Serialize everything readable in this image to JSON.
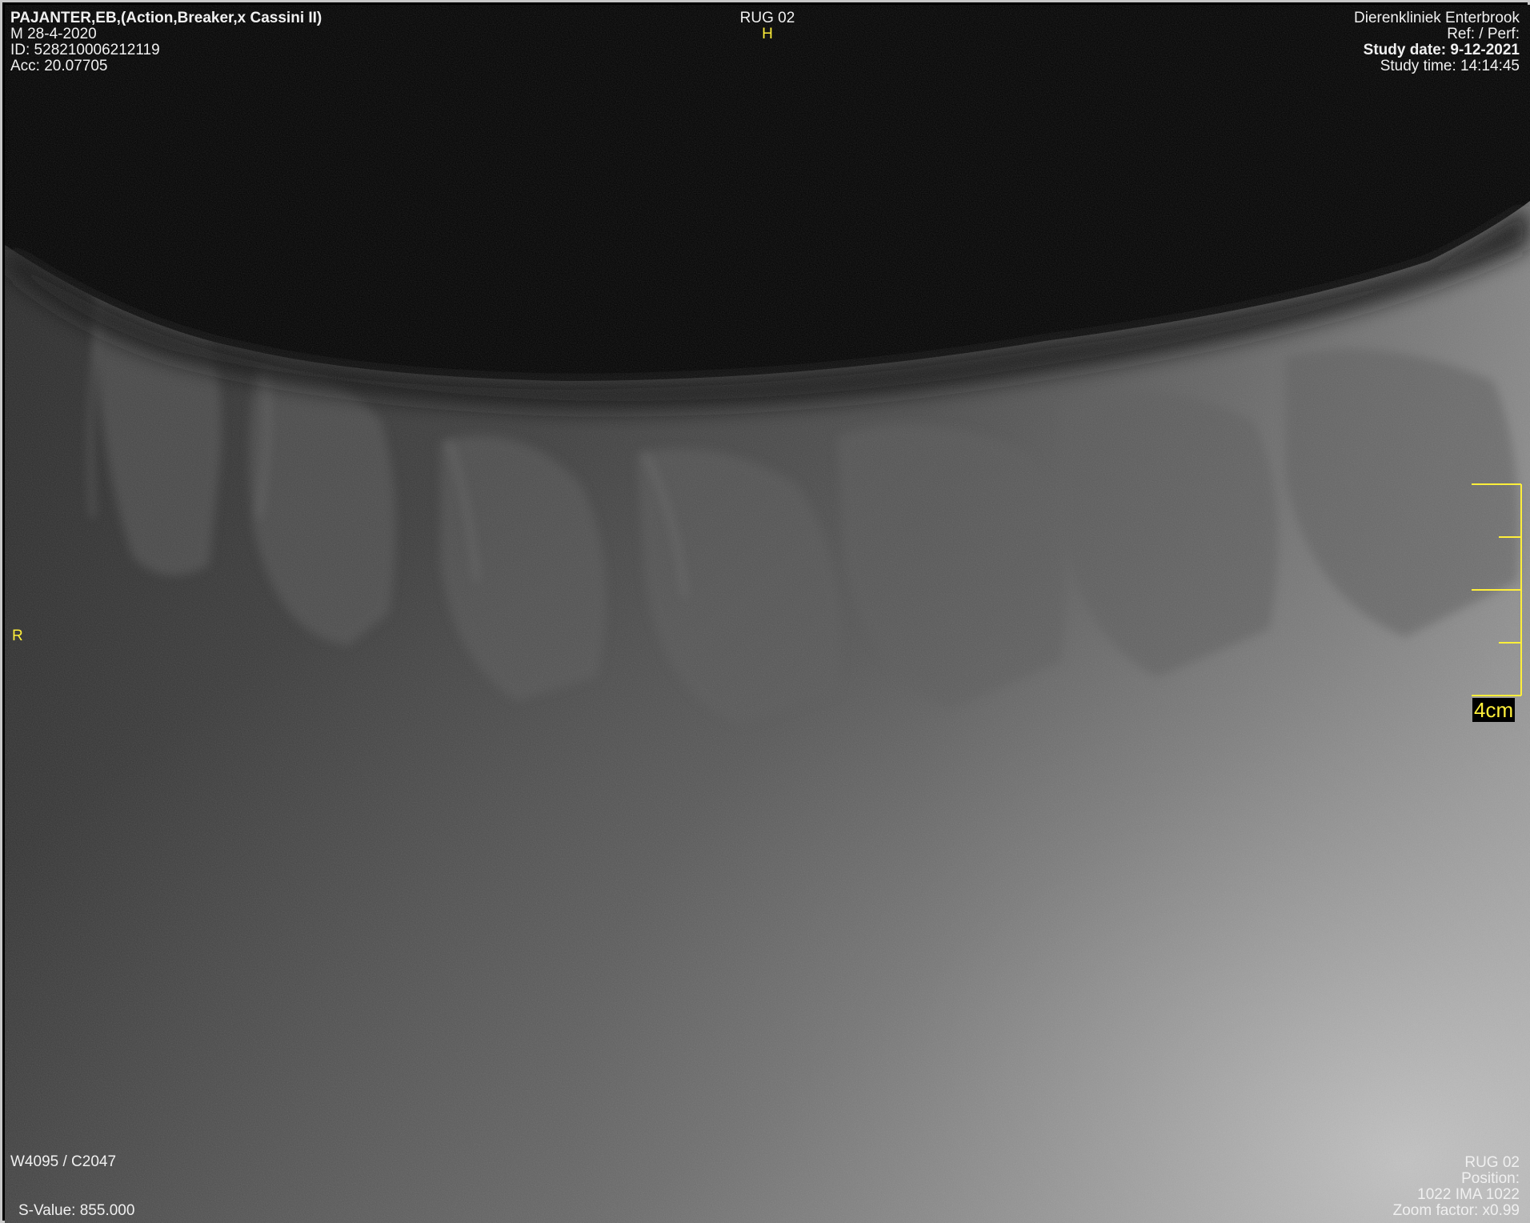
{
  "patient": {
    "name": "PAJANTER,EB,(Action,Breaker,x Cassini II)",
    "sex_birth": "M  28-4-2020",
    "id": "ID: 528210006212119",
    "accession": "Acc: 20.07705"
  },
  "series": {
    "title": "RUG 02",
    "orientation_top": "H",
    "orientation_left": "R"
  },
  "institution": {
    "name": "Dierenkliniek Enterbrook",
    "ref_perf": "Ref:  / Perf:",
    "study_date": "Study date: 9-12-2021",
    "study_time": "Study time: 14:14:45"
  },
  "window": {
    "wl": "W4095 / C2047",
    "s_value": "S-Value: 855.000"
  },
  "image_info": {
    "series": "RUG 02",
    "position": "Position:",
    "image_index": "1022 IMA 1022",
    "zoom": "Zoom factor: x0.99"
  },
  "scale": {
    "label": "4cm",
    "segments": 4
  },
  "colors": {
    "overlay_text": "#f0f0f0",
    "annotation": "#ffef3a",
    "background": "#000000"
  }
}
